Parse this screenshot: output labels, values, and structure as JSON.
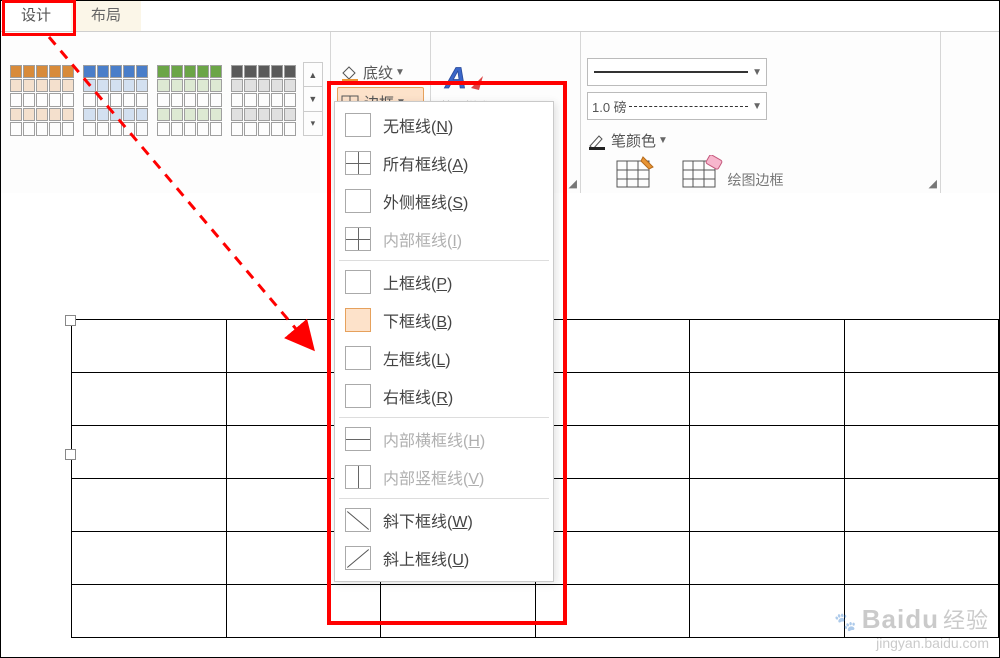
{
  "tabs": {
    "design": "设计",
    "layout": "布局"
  },
  "ribbon": {
    "shading": "底纹",
    "border": "边框",
    "quick_style": "快速样式",
    "line_weight": "1.0 磅",
    "pen_color": "笔颜色",
    "draw_table": "绘制表格",
    "eraser": "橡皮擦",
    "draw_group_label": "绘图边框"
  },
  "border_menu": [
    {
      "key": "none",
      "label": "无框线",
      "accel": "N",
      "enabled": true,
      "icon": "none"
    },
    {
      "key": "all",
      "label": "所有框线",
      "accel": "A",
      "enabled": true,
      "icon": "all"
    },
    {
      "key": "outside",
      "label": "外侧框线",
      "accel": "S",
      "enabled": true,
      "icon": "outside"
    },
    {
      "key": "inside",
      "label": "内部框线",
      "accel": "I",
      "enabled": false,
      "icon": "inside"
    },
    {
      "sep": true
    },
    {
      "key": "top",
      "label": "上框线",
      "accel": "P",
      "enabled": true,
      "icon": "top"
    },
    {
      "key": "bottom",
      "label": "下框线",
      "accel": "B",
      "enabled": true,
      "icon": "bottom",
      "selected": true
    },
    {
      "key": "left",
      "label": "左框线",
      "accel": "L",
      "enabled": true,
      "icon": "left-b"
    },
    {
      "key": "right",
      "label": "右框线",
      "accel": "R",
      "enabled": true,
      "icon": "right-b"
    },
    {
      "sep": true
    },
    {
      "key": "ih",
      "label": "内部横框线",
      "accel": "H",
      "enabled": false,
      "icon": "ih"
    },
    {
      "key": "iv",
      "label": "内部竖框线",
      "accel": "V",
      "enabled": false,
      "icon": "iv"
    },
    {
      "sep": true
    },
    {
      "key": "diag_down",
      "label": "斜下框线",
      "accel": "W",
      "enabled": true,
      "icon": "diag1"
    },
    {
      "key": "diag_up",
      "label": "斜上框线",
      "accel": "U",
      "enabled": true,
      "icon": "diag2"
    }
  ],
  "doc_table": {
    "rows": 6,
    "cols": 6
  },
  "watermark": {
    "brand": "Baidu",
    "brand_cn": "经验",
    "url": "jingyan.baidu.com"
  }
}
